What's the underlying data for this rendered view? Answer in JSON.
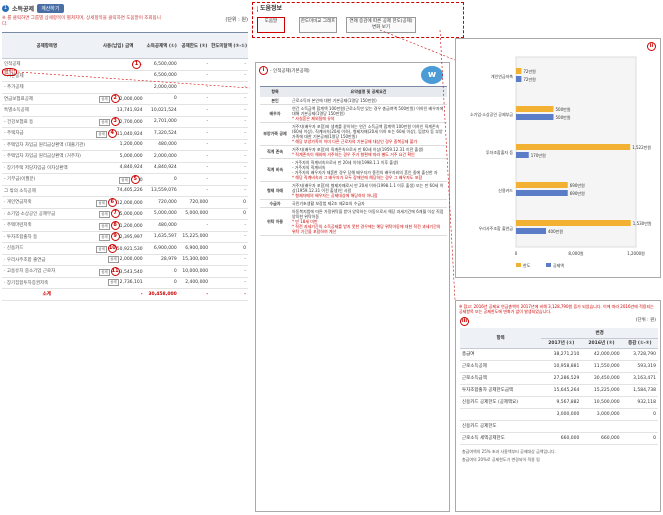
{
  "left": {
    "index": "1",
    "title": "소득공제",
    "calc_button": "계산하기",
    "note": "※ 를 클릭하면 그룹별 상세항목이 펼쳐지며, 상세항목을 클릭하면 도움말이 조회됩니다.",
    "unit": "(단위 : 원)",
    "headers": [
      "공제항목명",
      "사용(납입) 금액",
      "소득공제액 (①)",
      "공제한도 (②)",
      "한도미달액 (②-①)"
    ],
    "rows": [
      {
        "name": "인적공제",
        "badge": "",
        "circ": "1",
        "c1": "-",
        "c2": "6,500,000",
        "c3": "-",
        "c4": "-"
      },
      {
        "name": "- 기본공제",
        "badge": "",
        "circ": "",
        "c1": "",
        "c2": "6,500,000",
        "c3": "-",
        "c4": "-"
      },
      {
        "name": "- 추가공제",
        "badge": "",
        "circ": "",
        "c1": "",
        "c2": "2,000,000",
        "c3": "-",
        "c4": "-"
      },
      {
        "name": "연금보험료공제",
        "badge": "상세",
        "circ": "2",
        "c1": "2,000,000",
        "c2": "0",
        "c3": "-",
        "c4": "-"
      },
      {
        "name": "특별소득공제",
        "badge": "",
        "circ": "",
        "c1": "13,741,924",
        "c2": "10,021,524",
        "c3": "-",
        "c4": "-"
      },
      {
        "name": "- 건강보험료 등",
        "badge": "상세",
        "circ": "3",
        "c1": "2,700,000",
        "c2": "2,701,000",
        "c3": "-",
        "c4": "-"
      },
      {
        "name": "- 주택자금",
        "badge": "상세",
        "circ": "4",
        "c1": "11,040,924",
        "c2": "7,320,524",
        "c3": "-",
        "c4": "-"
      },
      {
        "name": "· 주택임차 차입금 원리금상환액 (대출기관)",
        "badge": "",
        "circ": "",
        "c1": "1,200,000",
        "c2": "480,000",
        "c3": "-",
        "c4": "-",
        "tall": true
      },
      {
        "name": "· 주택임차 차입금 원리금상환액 (거주자)",
        "badge": "",
        "circ": "",
        "c1": "5,000,000",
        "c2": "2,000,000",
        "c3": "-",
        "c4": "-",
        "tall": true
      },
      {
        "name": "· 장기주택 저당차입금 이자상환액",
        "badge": "",
        "circ": "",
        "c1": "4,840,924",
        "c2": "4,840,924",
        "c3": "-",
        "c4": "-",
        "tall": true
      },
      {
        "name": "- 기부금(이월분)",
        "badge": "상세",
        "circ": "5",
        "c1": "0",
        "c2": "0",
        "c3": "-",
        "c4": "-"
      },
      {
        "name": "그 밖의 소득공제",
        "badge": "",
        "circ": "",
        "c1": "74,405,226",
        "c2": "13,559,076",
        "c3": "-",
        "c4": "-"
      },
      {
        "name": "· 개인연금저축",
        "badge": "상세",
        "circ": "6",
        "c1": "12,000,000",
        "c2": "720,000",
        "c3": "720,000",
        "c4": "0"
      },
      {
        "name": "· 소기업·소상공인 공제부금",
        "badge": "상세",
        "circ": "7",
        "c1": "5,000,000",
        "c2": "5,000,000",
        "c3": "5,000,000",
        "c4": "0"
      },
      {
        "name": "· 주택마련저축",
        "badge": "상세",
        "circ": "8",
        "c1": "1,200,000",
        "c2": "480,000",
        "c3": "-",
        "c4": "-"
      },
      {
        "name": "· 투자조합출자 등",
        "badge": "상세",
        "circ": "9",
        "c1": "2,395,997",
        "c2": "1,635,597",
        "c3": "15,225,000",
        "c4": "-"
      },
      {
        "name": "· 신용카드",
        "badge": "상세",
        "circ": "10",
        "c1": "50,921,530",
        "c2": "6,900,000",
        "c3": "6,900,000",
        "c4": "0"
      },
      {
        "name": "· 우리사주조합 출연금",
        "badge": "상세",
        "circ": "",
        "c1": "2,000,000",
        "c2": "28,979",
        "c3": "15,300,000",
        "c4": "-"
      },
      {
        "name": "· 고용유지 중소기업 근로자",
        "badge": "상세",
        "circ": "11",
        "c1": "3,543,540",
        "c2": "0",
        "c3": "10,000,000",
        "c4": "-"
      },
      {
        "name": "· 장기집합투자증권저축",
        "badge": "상세",
        "circ": "",
        "c1": "2,736,101",
        "c2": "0",
        "c3": "2,400,000",
        "c4": "-"
      }
    ],
    "total": {
      "name": "소계",
      "c1": "-",
      "c2": "30,458,000",
      "c3": "-",
      "c4": "-"
    },
    "callout_label": "클릭!"
  },
  "rhead": {
    "title": "도움정보",
    "tabs": [
      "도움말",
      "한도미비교 그래프",
      "연례 증감에 따른 공제 한도(공제) 변화 보기"
    ]
  },
  "expl": {
    "roman": "i",
    "subtitle": "- 인적공제(기본공제)",
    "headers": [
      "항목",
      "요약설명 및 공제요건"
    ],
    "rows": [
      {
        "k": "본인",
        "v": "근로소득자 본인에 대한 기본공제(1명당 150만원)"
      },
      {
        "k": "배우자",
        "v": "연간 소득금액 합계액 100만원(근로소득만 있는 경우 총급여액 500만원) 이하인 배우자에 대해 기본공제(1명당 150만원)",
        "r": "* 사실혼은 제외됨에 유의"
      },
      {
        "k": "부양가족 공제",
        "v": "거주자(배우자 포함)와 생계를 같이하는 연간 소득금액 합계액 100만원 이하인 직계존속(60세 이상), 직계비속(20세 이하), 형제자매(20세 이하 또는 60세 이상), 입양자 등 부양가족에 대한 기본공제(1명당 150만원)",
        "r": "* 해당 부양가족이 이미 다른 근로자의 기본공제 대상인 경우 중복공제 불가"
      },
      {
        "k": "직계 존속",
        "v": "거주자(배우자 포함)의 직계존속으로서 만 60세 이상(1959.12.31 이전 출생)",
        "r": "* 직계존속이 해외에 거주하는 경우 주거 형편에 따라 별도 거주 요건 확인"
      },
      {
        "k": "직계 비속",
        "v": "- 거주자의 직계비속으로서 만 20세 이하(1998.1.1 이후 출생)\n- 거주자의 직계비속\n- 거주자의 배우자가 재혼한 경우 당해 배우자가 종전의 배우자와의 혼인 중에 출산한 자",
        "r": "* 해당 직계비속과 그 배우자가 모두 장애인에 해당하는 경우 그 배우자도 포함"
      },
      {
        "k": "형제 자매",
        "v": "거주자(배우자 포함)의 형제자매로서 만 20세 이하(1998.1.1 이후 출생) 또는 만 60세 이상(1959.12.31 이전 출생)인 사람",
        "r": "* 형제자매의 배우자는 공제대상에 해당하지 아니함"
      },
      {
        "k": "수급자",
        "v": "국민기초생활 보장법 제2조 제2호의 수급자"
      },
      {
        "k": "위탁 아동",
        "v": "아동복지법에 따른 가정위탁을 받아 양육하는 아동으로서 해당 과세기간에 6개월 이상 직접 양육한 위탁아동",
        "r": "* 만 18세 미만\n* 직전 과세기간의 소득공제를 받지 못한 경우에는 해당 위탁아동에 대한 직전 과세기간의 위탁 기간을 포함하여 계산"
      }
    ]
  },
  "chart": {
    "roman": "ii",
    "legend": [
      "한도",
      "공제액"
    ],
    "chart_data": {
      "type": "bar",
      "orientation": "horizontal",
      "categories": [
        "개인연금저축",
        "소기업·소상공인 공제부금",
        "투자조합출자 등",
        "신용카드",
        "우리사주조합 출연금"
      ],
      "series": [
        {
          "name": "한도",
          "values": [
            720000,
            5000000,
            15225000,
            6900000,
            15300000
          ]
        },
        {
          "name": "공제액",
          "values": [
            720000,
            5000000,
            1700000,
            6900000,
            4000000
          ]
        }
      ],
      "bar_labels": [
        [
          "72만원",
          "72만원"
        ],
        [
          "500만원",
          "500만원"
        ],
        [
          "1,522만원",
          "170만원"
        ],
        [
          "690만원",
          "690만원"
        ],
        [
          "1,530만원",
          "400만원"
        ]
      ],
      "xticks": [
        "0",
        "8,000원",
        "1,2000원"
      ],
      "xlim": [
        0,
        16000000
      ]
    }
  },
  "tbl": {
    "roman": "iii",
    "note": "※ 참고: 2016년 공제요 연금총액이 2017년에 비해 3,128,790원 증가 되었습니다. 이에 따라 2016년에 적용되는 공제항목 또는 공제한도에 변화가 없이 발생되었습니다.",
    "unit": "(단위 : 원)",
    "group_header": "변경",
    "headers": [
      "항목",
      "2017년 (①)",
      "2016년 (②)",
      "증감 (①-②)"
    ],
    "rows": [
      {
        "k": "총급여",
        "a": "38,271,210",
        "b": "42,000,000",
        "c": "3,728,790"
      },
      {
        "k": "근로소득공제",
        "a": "10,958,881",
        "b": "11,550,000",
        "c": "593,319"
      },
      {
        "k": "근로소득금액",
        "a": "27,286,529",
        "b": "30,450,000",
        "c": "3,163,471"
      },
      {
        "k": "투자조합출자 공제한도금액",
        "a": "15,645,264",
        "b": "15,225,000",
        "c": "1,584,738"
      },
      {
        "k": "신용카드 공제한도 (공제액요)",
        "a": "9,567,882",
        "b": "10,500,000",
        "c": "932,118"
      },
      {
        "k": "",
        "a": "3,000,000",
        "b": "3,000,000",
        "c": "0"
      },
      {
        "k": "신용카드 공제한도",
        "a": "",
        "b": "",
        "c": ""
      },
      {
        "k": "근로소득 세액공제한도",
        "a": "660,000",
        "b": "660,000",
        "c": "0"
      }
    ],
    "cc_note": "총급여액의 25% 초과 사용액부터 공제대상 금액입니다.",
    "cc_note2": "총급여의 20%로 공제한도가 변경되어 적용 됨"
  },
  "colors": {
    "accent": "#2a6db5",
    "alert": "#c00000",
    "bar_limit": "#f2b132",
    "bar_deduct": "#5b7dc8"
  }
}
